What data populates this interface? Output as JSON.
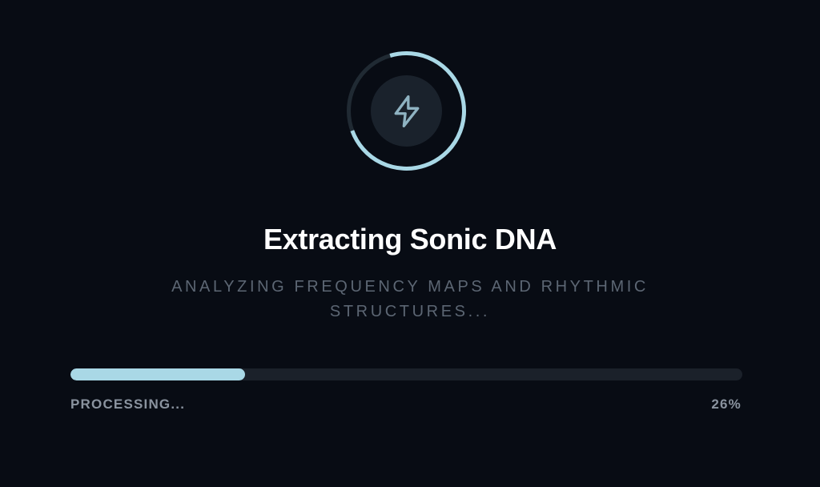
{
  "loader": {
    "icon": "lightning-bolt-icon",
    "progress_fraction": 0.26
  },
  "title": "Extracting Sonic DNA",
  "subtitle": "ANALYZING FREQUENCY MAPS AND RHYTHMIC STRUCTURES...",
  "progress": {
    "status_label": "PROCESSING...",
    "percent_label": "26%",
    "value": 0.26
  },
  "colors": {
    "background": "#080c14",
    "accent": "#a9d8e6",
    "track": "#1b212a",
    "icon": "#8fb3c2",
    "muted_text": "#8a939f",
    "subtitle_text": "#5c6673"
  }
}
